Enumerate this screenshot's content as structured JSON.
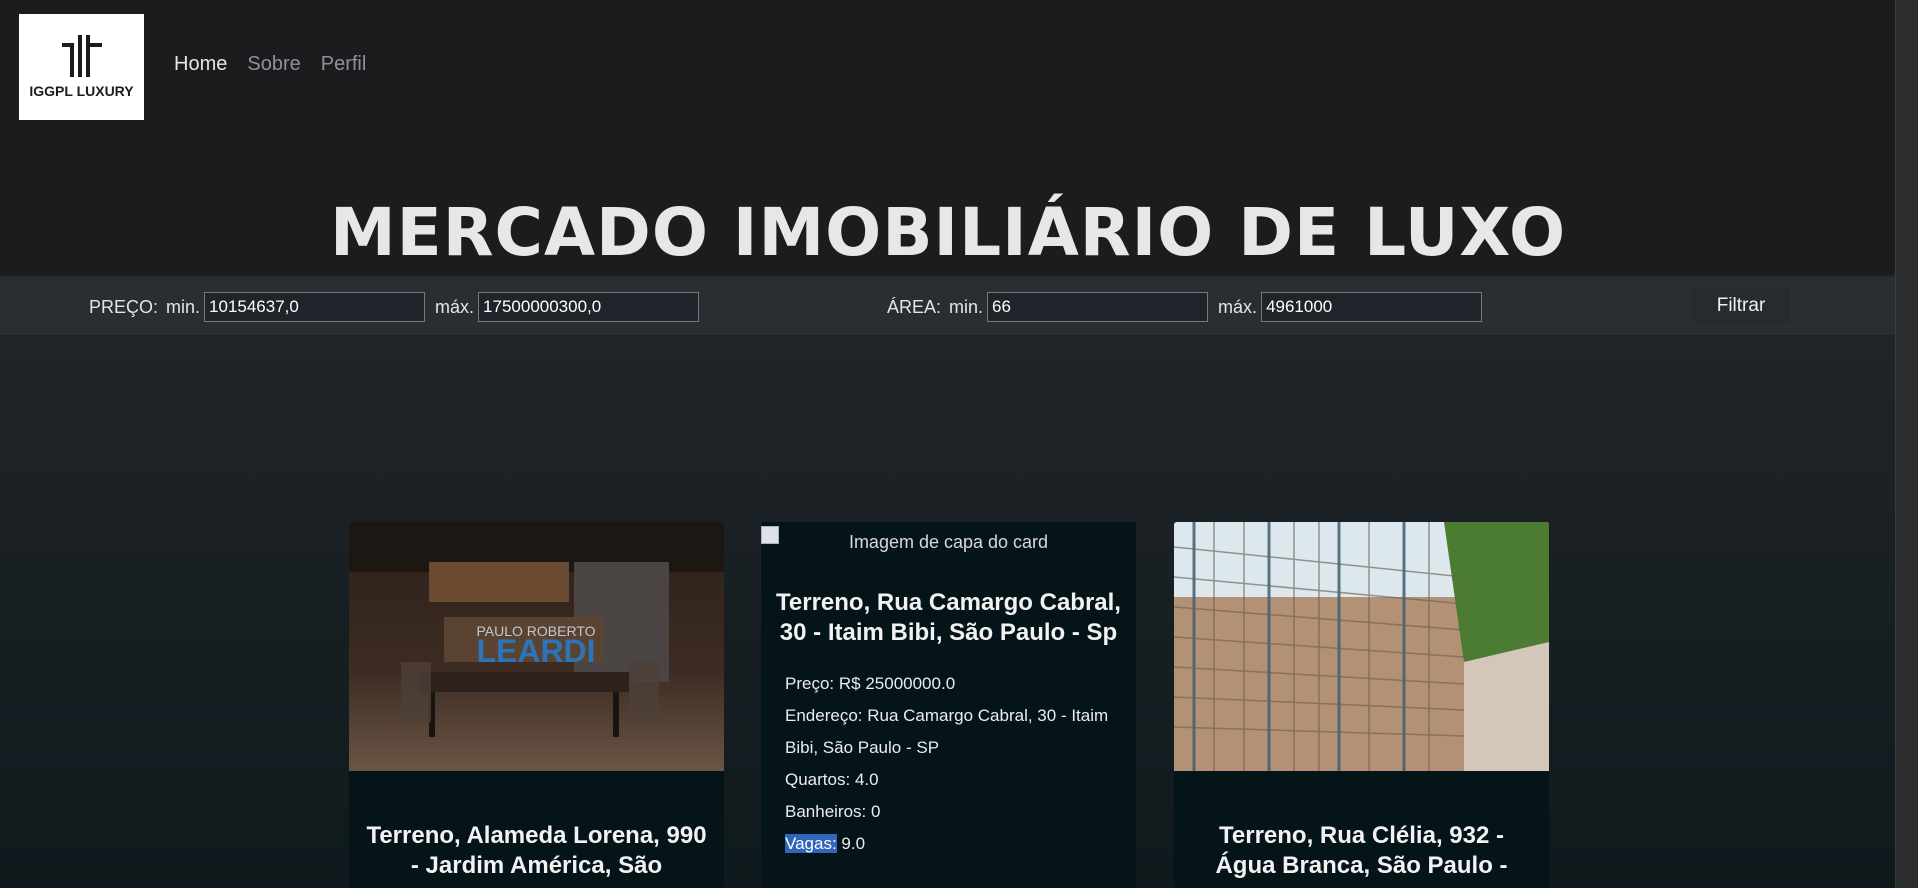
{
  "brand": {
    "logo_text": "IGGPL LUXURY"
  },
  "nav": {
    "items": [
      {
        "label": "Home"
      },
      {
        "label": "Sobre"
      },
      {
        "label": "Perfil"
      }
    ]
  },
  "hero": {
    "title": "MERCADO IMOBILIÁRIO DE LUXO"
  },
  "filters": {
    "price_label": "PREÇO:",
    "area_label": "ÁREA:",
    "min_label": "min.",
    "max_label": "máx.",
    "price_min": "10154637,0",
    "price_max": "17500000300,0",
    "area_min": "66",
    "area_max": "4961000",
    "button_label": "Filtrar"
  },
  "cards": [
    {
      "title": "Terreno, Alameda Lorena, 990 - Jardim América, São"
    },
    {
      "image_alt": "Imagem de capa do card",
      "title": "Terreno, Rua Camargo Cabral, 30 - Itaim Bibi, São Paulo - Sp",
      "price_label": "Preço:",
      "price": "R$ 25000000.0",
      "address_label": "Endereço:",
      "address": "Rua Camargo Cabral, 30 - Itaim Bibi, São Paulo - SP",
      "rooms_label": "Quartos:",
      "rooms": "4.0",
      "baths_label": "Banheiros:",
      "baths": "0",
      "spots_label": "Vagas:",
      "spots": "9.0"
    },
    {
      "title": "Terreno, Rua Clélia, 932 - Água Branca, São Paulo -"
    }
  ],
  "colors": {
    "accent": "#2f66b9",
    "background": "#1b1c1e",
    "card": "#051419"
  }
}
